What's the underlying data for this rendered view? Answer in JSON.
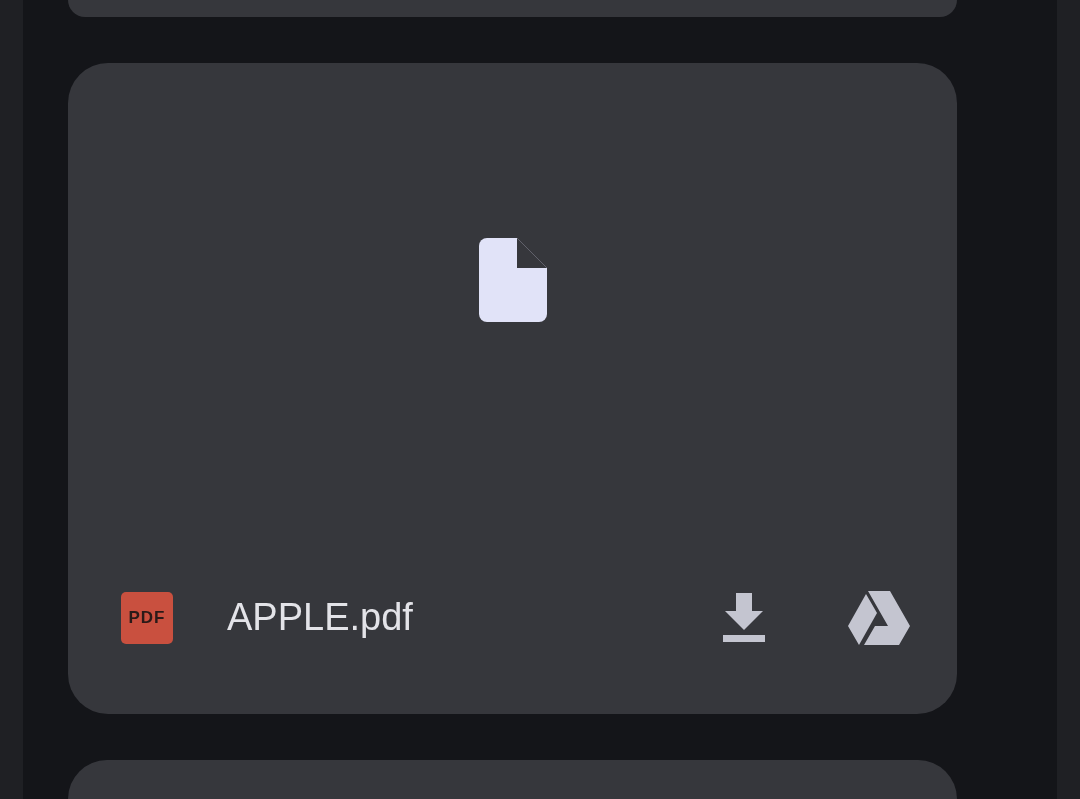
{
  "attachment": {
    "badge": "PDF",
    "file_name": "APPLE.pdf"
  }
}
